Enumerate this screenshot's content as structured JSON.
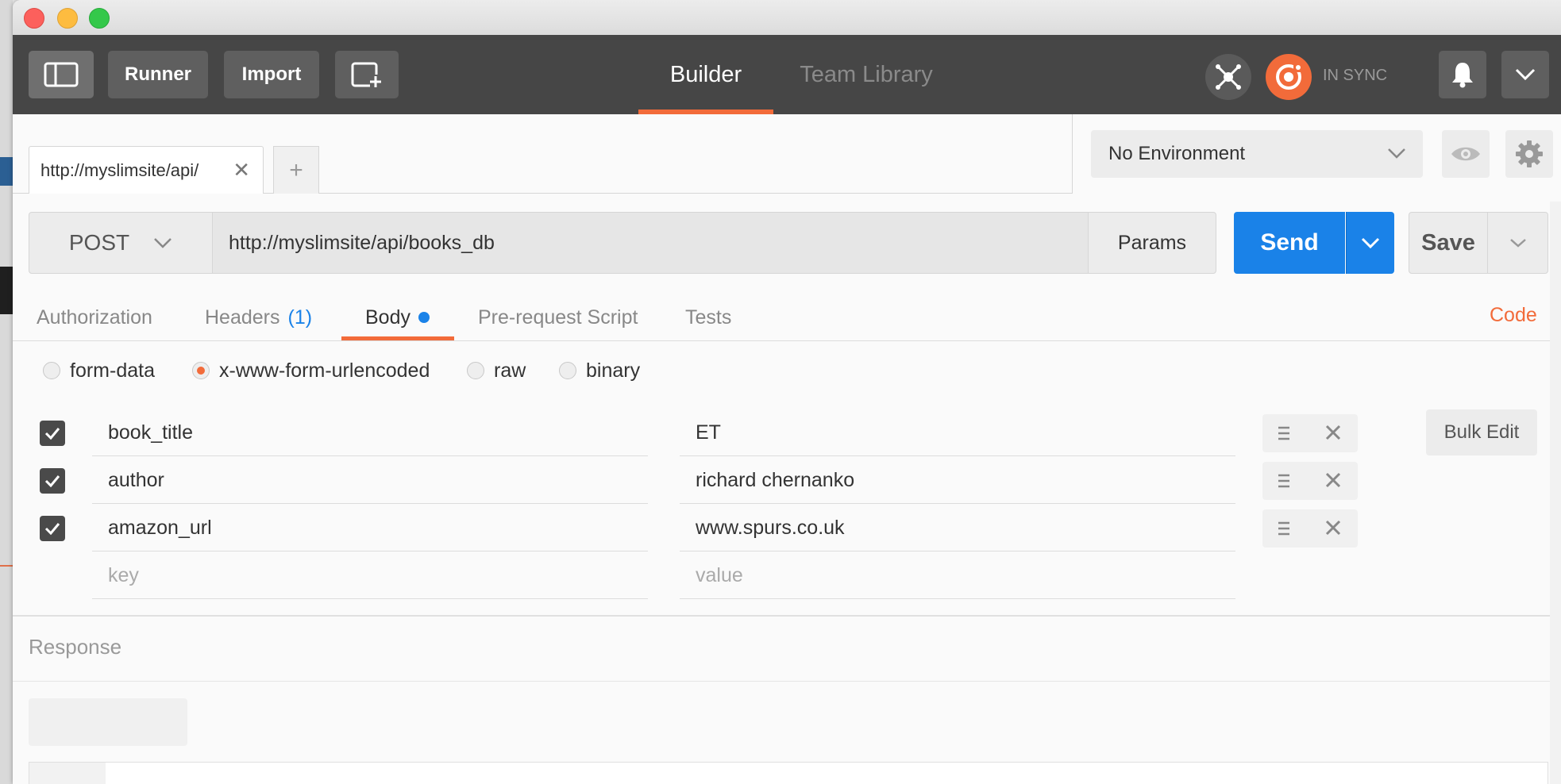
{
  "toolbar": {
    "runner": "Runner",
    "import": "Import",
    "tabs": [
      "Builder",
      "Team Library"
    ],
    "sync_status": "IN SYNC"
  },
  "request_tab": {
    "title": "http://myslimsite/api/",
    "add": "+"
  },
  "environment": {
    "selected": "No Environment"
  },
  "request": {
    "method": "POST",
    "url": "http://myslimsite/api/books_db",
    "params_label": "Params",
    "send_label": "Send",
    "save_label": "Save"
  },
  "sub_tabs": {
    "authorization": "Authorization",
    "headers": "Headers",
    "headers_count": "(1)",
    "body": "Body",
    "pre_request": "Pre-request Script",
    "tests": "Tests",
    "code": "Code"
  },
  "body_types": [
    "form-data",
    "x-www-form-urlencoded",
    "raw",
    "binary"
  ],
  "body_type_selected": "x-www-form-urlencoded",
  "params": [
    {
      "key": "book_title",
      "value": "ET",
      "enabled": true
    },
    {
      "key": "author",
      "value": "richard chernanko",
      "enabled": true
    },
    {
      "key": "amazon_url",
      "value": "www.spurs.co.uk",
      "enabled": true
    }
  ],
  "placeholders": {
    "key": "key",
    "value": "value"
  },
  "bulk_edit": "Bulk Edit",
  "response": {
    "title": "Response"
  },
  "colors": {
    "accent": "#f26b3a",
    "send_blue": "#1a82e8",
    "toolbar_bg": "#464646"
  },
  "icons": [
    "sidebar-toggle-icon",
    "new-window-icon",
    "interceptor-icon",
    "sync-icon",
    "bell-icon",
    "chevron-down-icon",
    "eye-icon",
    "gear-icon",
    "close-icon",
    "checkbox-checked-icon",
    "drag-handle-icon"
  ]
}
